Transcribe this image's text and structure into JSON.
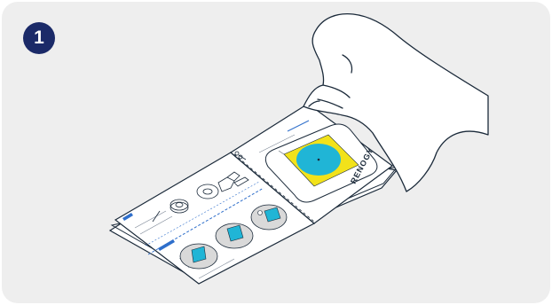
{
  "step": {
    "number": "1"
  },
  "booklet": {
    "brand": "RENOGY"
  },
  "colors": {
    "background": "#eeeeee",
    "badge": "#1b2a68",
    "accent_blue": "#2f6fcb",
    "sticker_yellow": "#f2e21a",
    "sticker_cyan": "#20b5d6",
    "line": "#1b2a3a"
  },
  "icons": {
    "hand": "hand-icon",
    "scissors": "scissors-icon"
  }
}
